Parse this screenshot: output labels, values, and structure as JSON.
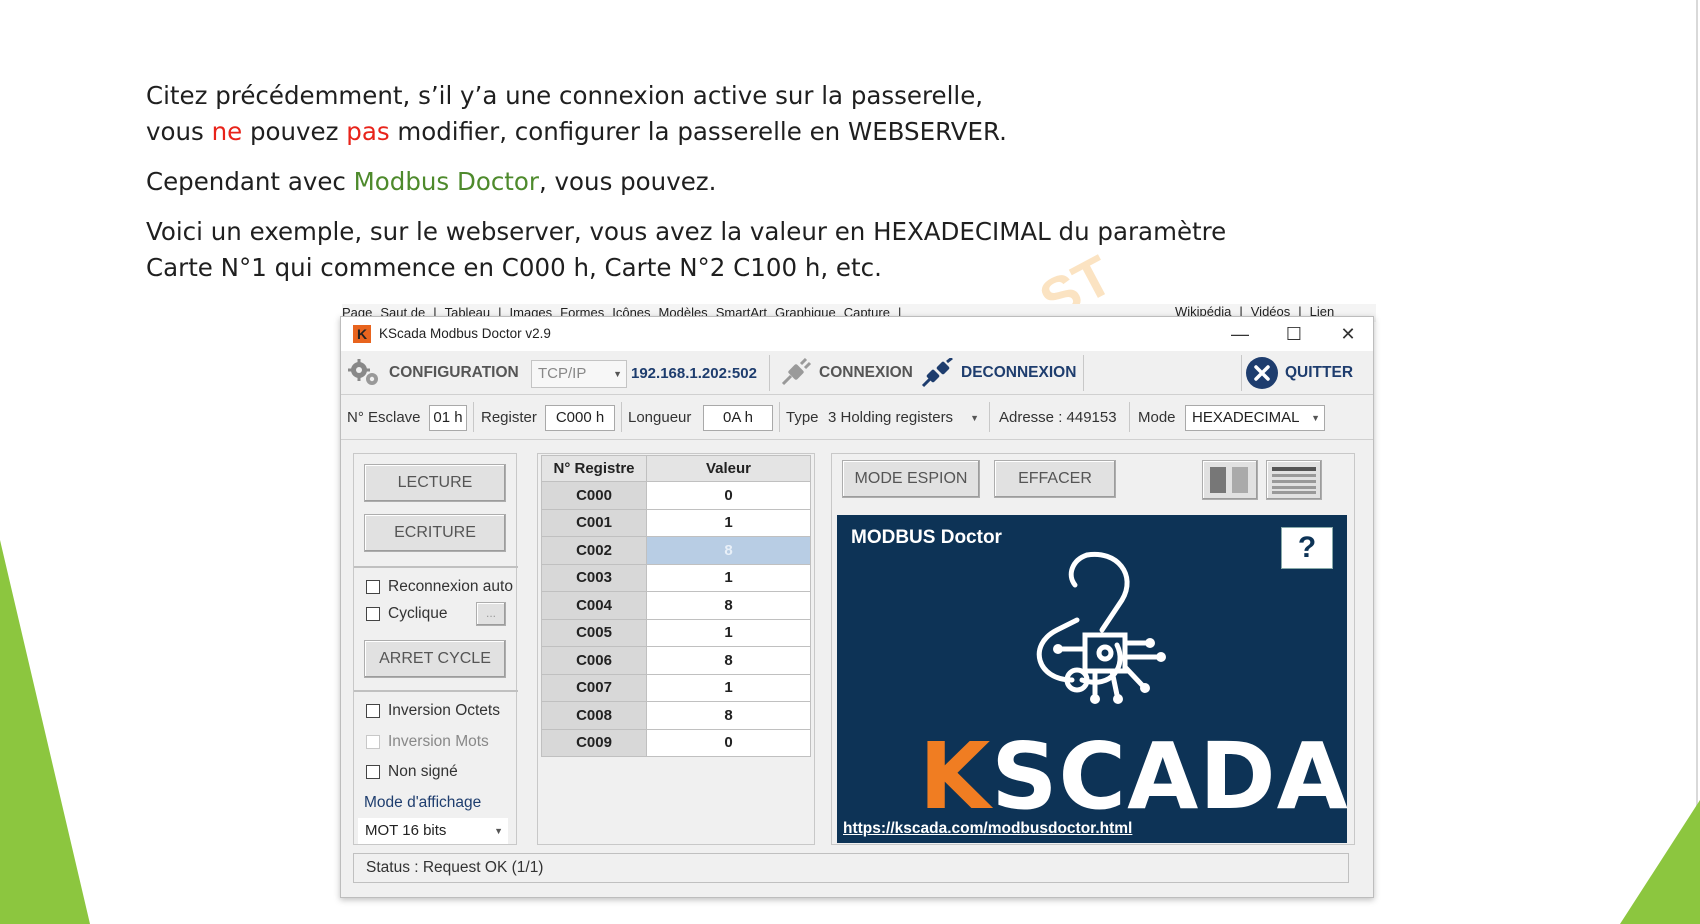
{
  "slide": {
    "p1_line1": "Citez précédemment, s’il y’a une connexion active sur la passerelle,",
    "p1_line2_a": "vous ",
    "p1_line2_ne": "ne",
    "p1_line2_b": " pouvez ",
    "p1_line2_pas": "pas",
    "p1_line2_c": " modifier, configurer la passerelle en WEBSERVER.",
    "p2_a": "Cependant avec ",
    "p2_brand": "Modbus Doctor",
    "p2_b": ", vous pouvez.",
    "p3_line1": "Voici un exemple, sur le webserver, vous avez la valeur en HEXADECIMAL du paramètre",
    "p3_line2": "Carte N°1 qui commence en C000 h, Carte N°2 C100 h, etc.",
    "watermark": "ST"
  },
  "ribbon": {
    "items": [
      "Page",
      "Saut de",
      "|",
      "Tableau",
      "|",
      "Images",
      "Formes",
      "Icônes",
      "Modèles",
      "SmartArt",
      "Graphique",
      "Capture",
      "|"
    ],
    "right_items": [
      "Wikipédia",
      "|",
      "Vidéos",
      "|",
      "Lien"
    ]
  },
  "window": {
    "title": "KScada Modbus Doctor v2.9",
    "logo_letter": "K",
    "minimize": "—",
    "maximize": "☐",
    "close": "✕"
  },
  "toolbar": {
    "configuration": "CONFIGURATION",
    "protocol": "TCP/IP",
    "address": "192.168.1.202:502",
    "connexion": "CONNEXION",
    "deconnexion": "DECONNEXION",
    "quitter": "QUITTER"
  },
  "params": {
    "esclave_label": "N° Esclave",
    "esclave_value": "01 h",
    "register_label": "Register",
    "register_value": "C000 h",
    "longueur_label": "Longueur",
    "longueur_value": "0A h",
    "type_label": "Type",
    "type_value": "3 Holding registers",
    "adresse": "Adresse : 449153",
    "mode_label": "Mode",
    "mode_value": "HEXADECIMAL"
  },
  "left_panel": {
    "lecture": "LECTURE",
    "ecriture": "ECRITURE",
    "reconnexion_auto": "Reconnexion auto",
    "cyclique": "Cyclique",
    "cyclique_btn": "...",
    "arret_cycle": "ARRET CYCLE",
    "inversion_octets": "Inversion Octets",
    "inversion_mots": "Inversion Mots",
    "non_signe": "Non signé",
    "mode_affichage_label": "Mode d'affichage",
    "mode_affichage_value": "MOT 16 bits"
  },
  "table": {
    "headers": [
      "N° Registre",
      "Valeur"
    ],
    "rows": [
      {
        "reg": "C000",
        "val": "0"
      },
      {
        "reg": "C001",
        "val": "1"
      },
      {
        "reg": "C002",
        "val": "8"
      },
      {
        "reg": "C003",
        "val": "1"
      },
      {
        "reg": "C004",
        "val": "8"
      },
      {
        "reg": "C005",
        "val": "1"
      },
      {
        "reg": "C006",
        "val": "8"
      },
      {
        "reg": "C007",
        "val": "1"
      },
      {
        "reg": "C008",
        "val": "8"
      },
      {
        "reg": "C009",
        "val": "0"
      }
    ],
    "selected_row": 2
  },
  "right_panel": {
    "mode_espion": "MODE ESPION",
    "effacer": "EFFACER",
    "brand_title": "MODBUS Doctor",
    "help": "?",
    "logo_k": "K",
    "logo_rest": "SCADA",
    "link": "https://kscada.com/modbusdoctor.html"
  },
  "status": {
    "text": "Status : Request OK (1/1)"
  },
  "colors": {
    "red": "#e8231a",
    "green": "#4e8a2c",
    "kscada_navy": "#0d3356",
    "kscada_orange": "#f07d22",
    "deco_green": "#8cc63f"
  }
}
